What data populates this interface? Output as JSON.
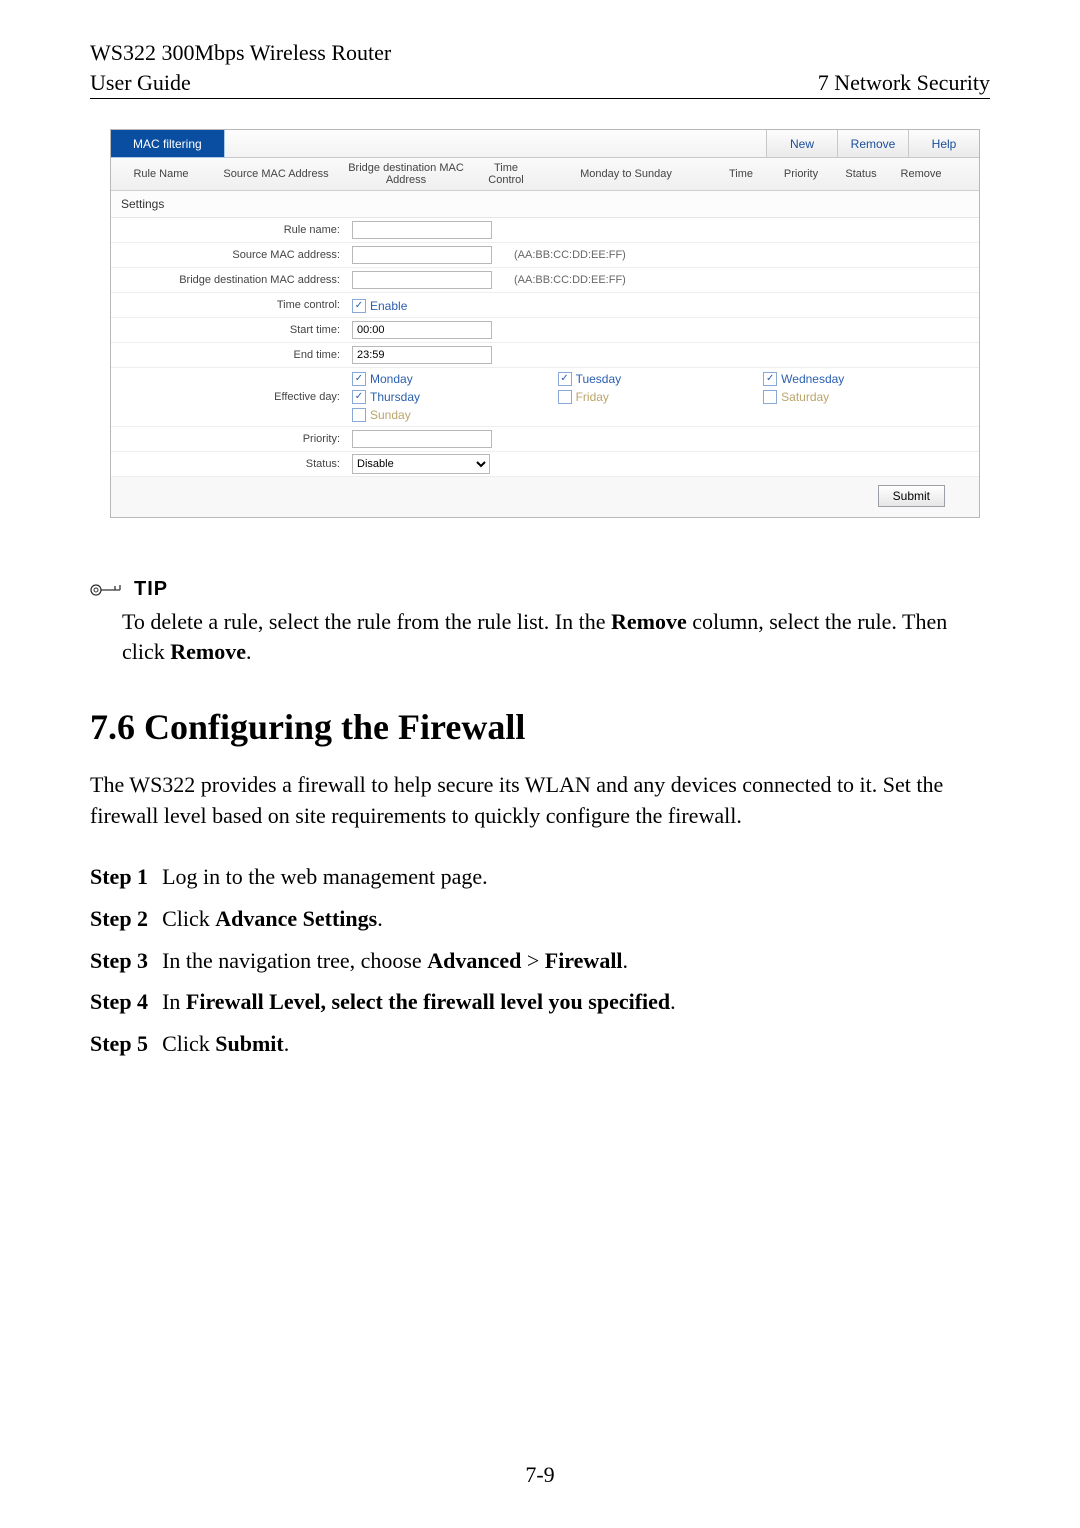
{
  "header": {
    "product": "WS322 300Mbps Wireless Router",
    "doc": "User Guide",
    "chapter": "7 Network Security"
  },
  "router": {
    "tab": "MAC filtering",
    "btn_new": "New",
    "btn_remove": "Remove",
    "btn_help": "Help",
    "cols": {
      "rule_name": "Rule Name",
      "src_mac": "Source MAC Address",
      "bridge_mac": "Bridge destination MAC Address",
      "time_ctrl": "Time Control",
      "mon_sun": "Monday to Sunday",
      "time": "Time",
      "priority": "Priority",
      "status": "Status",
      "remove": "Remove"
    },
    "section": "Settings",
    "labels": {
      "rule_name": "Rule name:",
      "src_mac": "Source MAC address:",
      "bridge_mac": "Bridge destination MAC address:",
      "time_ctrl": "Time control:",
      "start": "Start time:",
      "end": "End time:",
      "eff_day": "Effective day:",
      "priority": "Priority:",
      "status": "Status:"
    },
    "fields": {
      "rule_name": "",
      "src_mac": "",
      "bridge_mac": "",
      "start": "00:00",
      "end": "23:59",
      "priority": "",
      "status": "Disable"
    },
    "hints": {
      "mac_fmt": "(AA:BB:CC:DD:EE:FF)"
    },
    "time_enable": "Enable",
    "days": {
      "mon": "Monday",
      "tue": "Tuesday",
      "wed": "Wednesday",
      "thu": "Thursday",
      "fri": "Friday",
      "sat": "Saturday",
      "sun": "Sunday"
    },
    "submit": "Submit"
  },
  "tip": {
    "label": "TIP",
    "text_pre": "To delete a rule, select the rule from the rule list. In the ",
    "text_bold1": "Remove",
    "text_mid": " column, select the rule. Then click ",
    "text_bold2": "Remove",
    "text_post": "."
  },
  "section_heading": "7.6  Configuring the Firewall",
  "intro": "The WS322 provides a firewall to help secure its WLAN and any devices connected to it. Set the firewall level based on site requirements to quickly configure the firewall.",
  "steps": {
    "s1_label": "Step 1",
    "s1_text": "Log in to the web management page.",
    "s2_label": "Step 2",
    "s2_pre": "Click ",
    "s2_b": "Advance Settings",
    "s2_post": ".",
    "s3_label": "Step 3",
    "s3_pre": "In the navigation tree, choose ",
    "s3_b1": "Advanced",
    "s3_mid": " > ",
    "s3_b2": "Firewall",
    "s3_post": ".",
    "s4_label": "Step 4",
    "s4_pre": "In ",
    "s4_b": "Firewall Level, select the firewall level you specified",
    "s4_post": ".",
    "s5_label": "Step 5",
    "s5_pre": "Click ",
    "s5_b": "Submit",
    "s5_post": "."
  },
  "page_number": "7-9"
}
